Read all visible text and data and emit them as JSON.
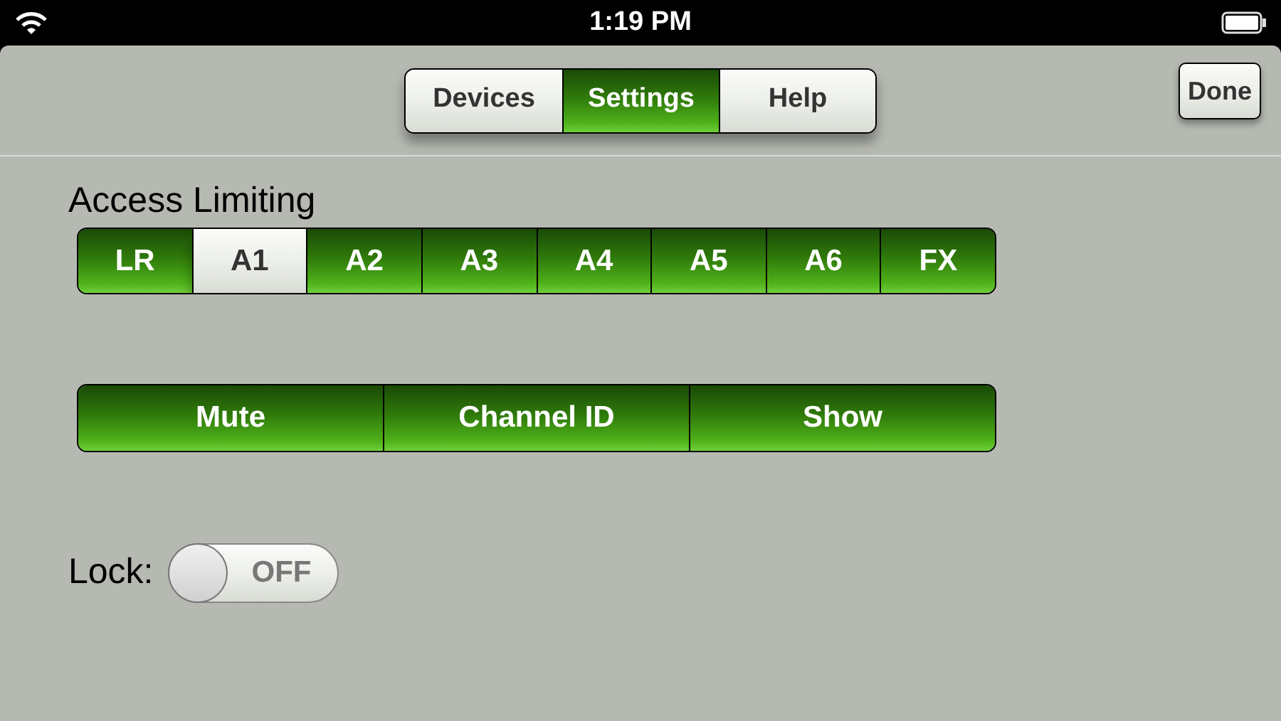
{
  "status_bar": {
    "time": "1:19 PM"
  },
  "tabs": [
    {
      "label": "Devices",
      "selected": false
    },
    {
      "label": "Settings",
      "selected": true
    },
    {
      "label": "Help",
      "selected": false
    }
  ],
  "done_button": "Done",
  "access_limiting": {
    "title": "Access Limiting",
    "segments": [
      {
        "label": "LR",
        "selected": false
      },
      {
        "label": "A1",
        "selected": true
      },
      {
        "label": "A2",
        "selected": false
      },
      {
        "label": "A3",
        "selected": false
      },
      {
        "label": "A4",
        "selected": false
      },
      {
        "label": "A5",
        "selected": false
      },
      {
        "label": "A6",
        "selected": false
      },
      {
        "label": "FX",
        "selected": false
      }
    ]
  },
  "options": [
    {
      "label": "Mute",
      "on": true
    },
    {
      "label": "Channel ID",
      "on": true
    },
    {
      "label": "Show",
      "on": true
    }
  ],
  "lock": {
    "label": "Lock:",
    "on": false,
    "state_text": "OFF"
  }
}
